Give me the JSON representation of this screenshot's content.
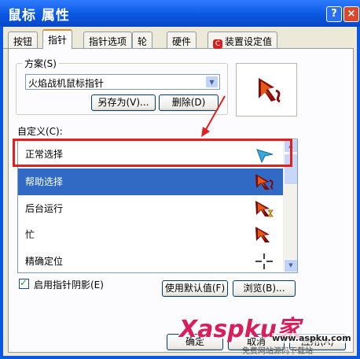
{
  "window": {
    "title": "鼠标 属性",
    "help_label": "?",
    "close_label": "×"
  },
  "tabs": [
    {
      "label": "按钮"
    },
    {
      "label": "指针"
    },
    {
      "label": "指针选项"
    },
    {
      "label": "轮"
    },
    {
      "label": "硬件"
    },
    {
      "label": "装置设定值"
    }
  ],
  "scheme": {
    "group_label": "方案(S)",
    "selected": "火焰战机鼠标指针",
    "save_as_label": "另存为(V)...",
    "delete_label": "删除(D)"
  },
  "custom": {
    "label": "自定义(C):",
    "items": [
      {
        "name": "正常选择",
        "icon": "arrow-pointer-icon"
      },
      {
        "name": "帮助选择",
        "icon": "flame-jet-help-icon"
      },
      {
        "name": "后台运行",
        "icon": "flame-jet-busy-icon"
      },
      {
        "name": "忙",
        "icon": "flame-jet-wait-icon"
      },
      {
        "name": "精确定位",
        "icon": "crosshair-icon"
      }
    ]
  },
  "shadow": {
    "label": "启用指针阴影(E)",
    "checked": true
  },
  "buttons": {
    "use_default": "使用默认值(F)",
    "browse": "浏览(B)...",
    "ok": "确定",
    "cancel": "取消",
    "apply": "应用(A)"
  },
  "watermark": {
    "brand": "Xaspku家",
    "site": "www.aspku.com",
    "sub": "免费网站源码下载站"
  },
  "colors": {
    "selection": "#316ac5",
    "highlight_box": "#e2201e",
    "titlebar": "#0a58e2",
    "tab_active_accent": "#e68b2c"
  }
}
